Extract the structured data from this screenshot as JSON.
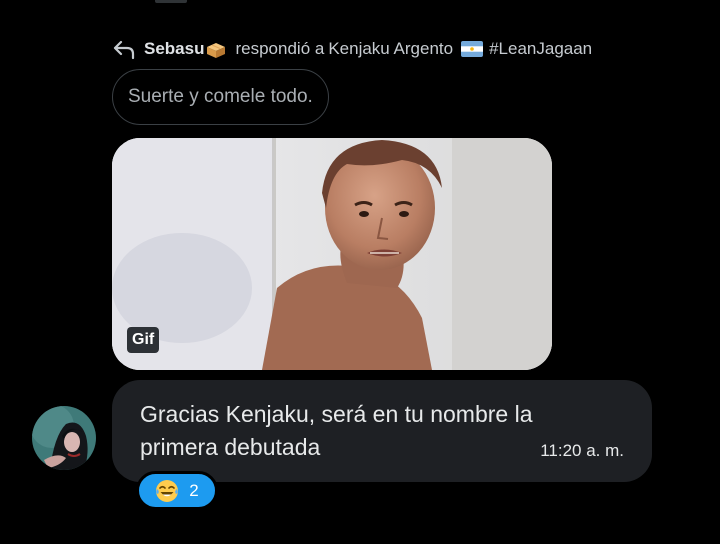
{
  "reply_header": {
    "author": "Sebasu",
    "author_emoji_icon": "bread-box-emoji-icon",
    "action": "respondió a",
    "target": "Kenjaku Argento",
    "flag_icon": "argentina-flag-icon",
    "hashtag": "#LeanJagaan"
  },
  "quoted_message": {
    "text": "Suerte y comele todo."
  },
  "media": {
    "badge": "Gif"
  },
  "message": {
    "text": "Gracias Kenjaku, será en tu nombre la primera debutada",
    "time": "11:20 a. m."
  },
  "reaction": {
    "emoji_icon": "laughing-tears-emoji-icon",
    "count": "2"
  },
  "colors": {
    "background": "#000000",
    "bubble": "#1e2024",
    "accent": "#1d9bf0",
    "text": "#e7e9ea",
    "muted": "#a9aeb3"
  }
}
